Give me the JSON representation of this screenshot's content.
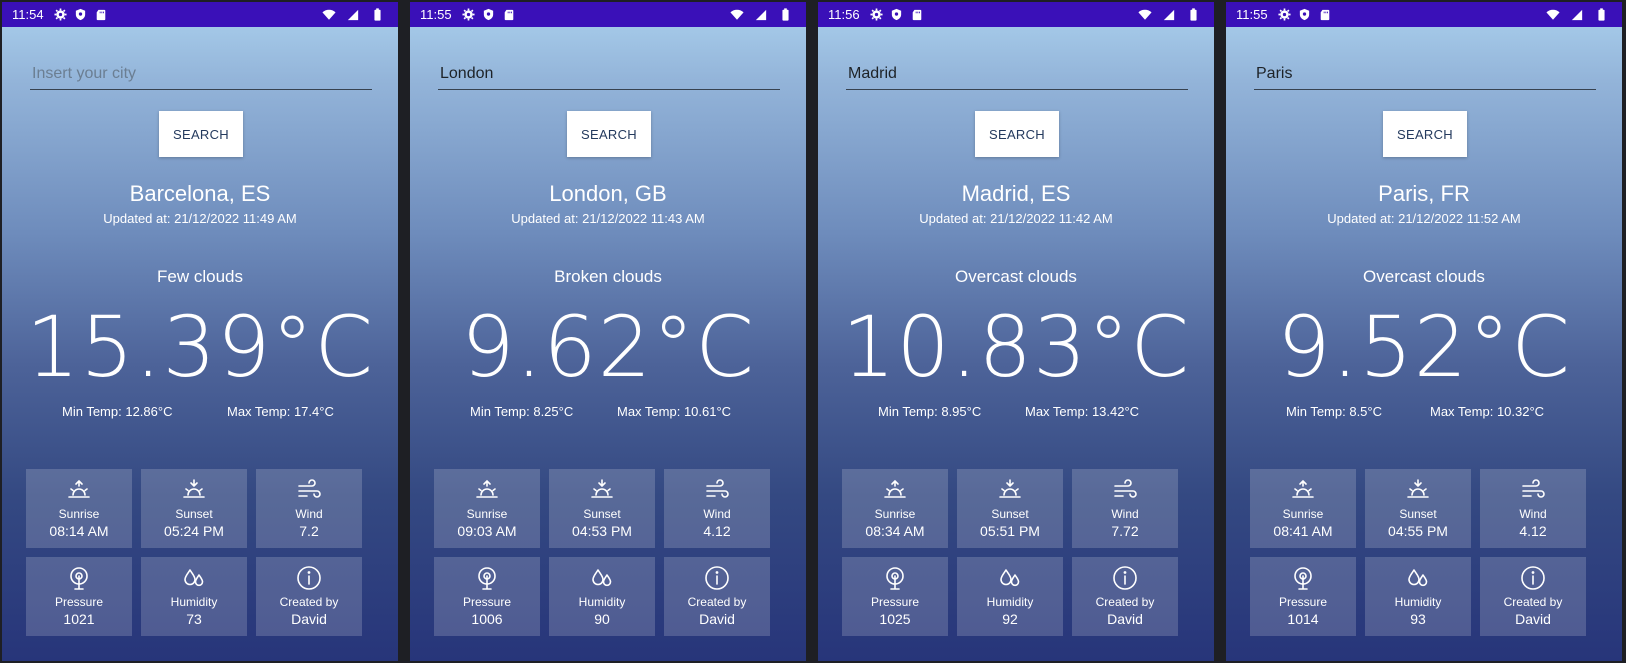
{
  "screens": [
    {
      "status_time": "11:54",
      "city_value": "",
      "city_placeholder": "Insert your city",
      "search_label": "SEARCH",
      "location": "Barcelona, ES",
      "updated": "Updated at: 21/12/2022 11:49 AM",
      "condition": "Few clouds",
      "temperature": "15.39°C",
      "min_temp": "Min Temp: 12.86°C",
      "max_temp": "Max Temp: 17.4°C",
      "tiles": [
        {
          "label": "Sunrise",
          "value": "08:14 AM",
          "icon": "sunrise-icon"
        },
        {
          "label": "Sunset",
          "value": "05:24 PM",
          "icon": "sunset-icon"
        },
        {
          "label": "Wind",
          "value": "7.2",
          "icon": "wind-icon"
        },
        {
          "label": "Pressure",
          "value": "1021",
          "icon": "pressure-icon"
        },
        {
          "label": "Humidity",
          "value": "73",
          "icon": "humidity-icon"
        },
        {
          "label": "Created by",
          "value": "David",
          "icon": "info-icon"
        }
      ]
    },
    {
      "status_time": "11:55",
      "city_value": "London",
      "city_placeholder": "Insert your city",
      "search_label": "SEARCH",
      "location": "London, GB",
      "updated": "Updated at: 21/12/2022 11:43 AM",
      "condition": "Broken clouds",
      "temperature": "9.62°C",
      "min_temp": "Min Temp: 8.25°C",
      "max_temp": "Max Temp: 10.61°C",
      "tiles": [
        {
          "label": "Sunrise",
          "value": "09:03 AM",
          "icon": "sunrise-icon"
        },
        {
          "label": "Sunset",
          "value": "04:53 PM",
          "icon": "sunset-icon"
        },
        {
          "label": "Wind",
          "value": "4.12",
          "icon": "wind-icon"
        },
        {
          "label": "Pressure",
          "value": "1006",
          "icon": "pressure-icon"
        },
        {
          "label": "Humidity",
          "value": "90",
          "icon": "humidity-icon"
        },
        {
          "label": "Created by",
          "value": "David",
          "icon": "info-icon"
        }
      ]
    },
    {
      "status_time": "11:56",
      "city_value": "Madrid",
      "city_placeholder": "Insert your city",
      "search_label": "SEARCH",
      "location": "Madrid, ES",
      "updated": "Updated at: 21/12/2022 11:42 AM",
      "condition": "Overcast clouds",
      "temperature": "10.83°C",
      "min_temp": "Min Temp: 8.95°C",
      "max_temp": "Max Temp: 13.42°C",
      "tiles": [
        {
          "label": "Sunrise",
          "value": "08:34 AM",
          "icon": "sunrise-icon"
        },
        {
          "label": "Sunset",
          "value": "05:51 PM",
          "icon": "sunset-icon"
        },
        {
          "label": "Wind",
          "value": "7.72",
          "icon": "wind-icon"
        },
        {
          "label": "Pressure",
          "value": "1025",
          "icon": "pressure-icon"
        },
        {
          "label": "Humidity",
          "value": "92",
          "icon": "humidity-icon"
        },
        {
          "label": "Created by",
          "value": "David",
          "icon": "info-icon"
        }
      ]
    },
    {
      "status_time": "11:55",
      "city_value": "Paris",
      "city_placeholder": "Insert your city",
      "search_label": "SEARCH",
      "location": "Paris, FR",
      "updated": "Updated at: 21/12/2022 11:52 AM",
      "condition": "Overcast clouds",
      "temperature": "9.52°C",
      "min_temp": "Min Temp: 8.5°C",
      "max_temp": "Max Temp: 10.32°C",
      "tiles": [
        {
          "label": "Sunrise",
          "value": "08:41 AM",
          "icon": "sunrise-icon"
        },
        {
          "label": "Sunset",
          "value": "04:55 PM",
          "icon": "sunset-icon"
        },
        {
          "label": "Wind",
          "value": "4.12",
          "icon": "wind-icon"
        },
        {
          "label": "Pressure",
          "value": "1014",
          "icon": "pressure-icon"
        },
        {
          "label": "Humidity",
          "value": "93",
          "icon": "humidity-icon"
        },
        {
          "label": "Created by",
          "value": "David",
          "icon": "info-icon"
        }
      ]
    }
  ],
  "colors": {
    "status_bar": "#3a10b8",
    "gradient_top": "#abd1ee",
    "gradient_bottom": "#27357a",
    "tile_bg": "rgba(255,255,255,0.18)",
    "button_text": "#243a5e"
  }
}
